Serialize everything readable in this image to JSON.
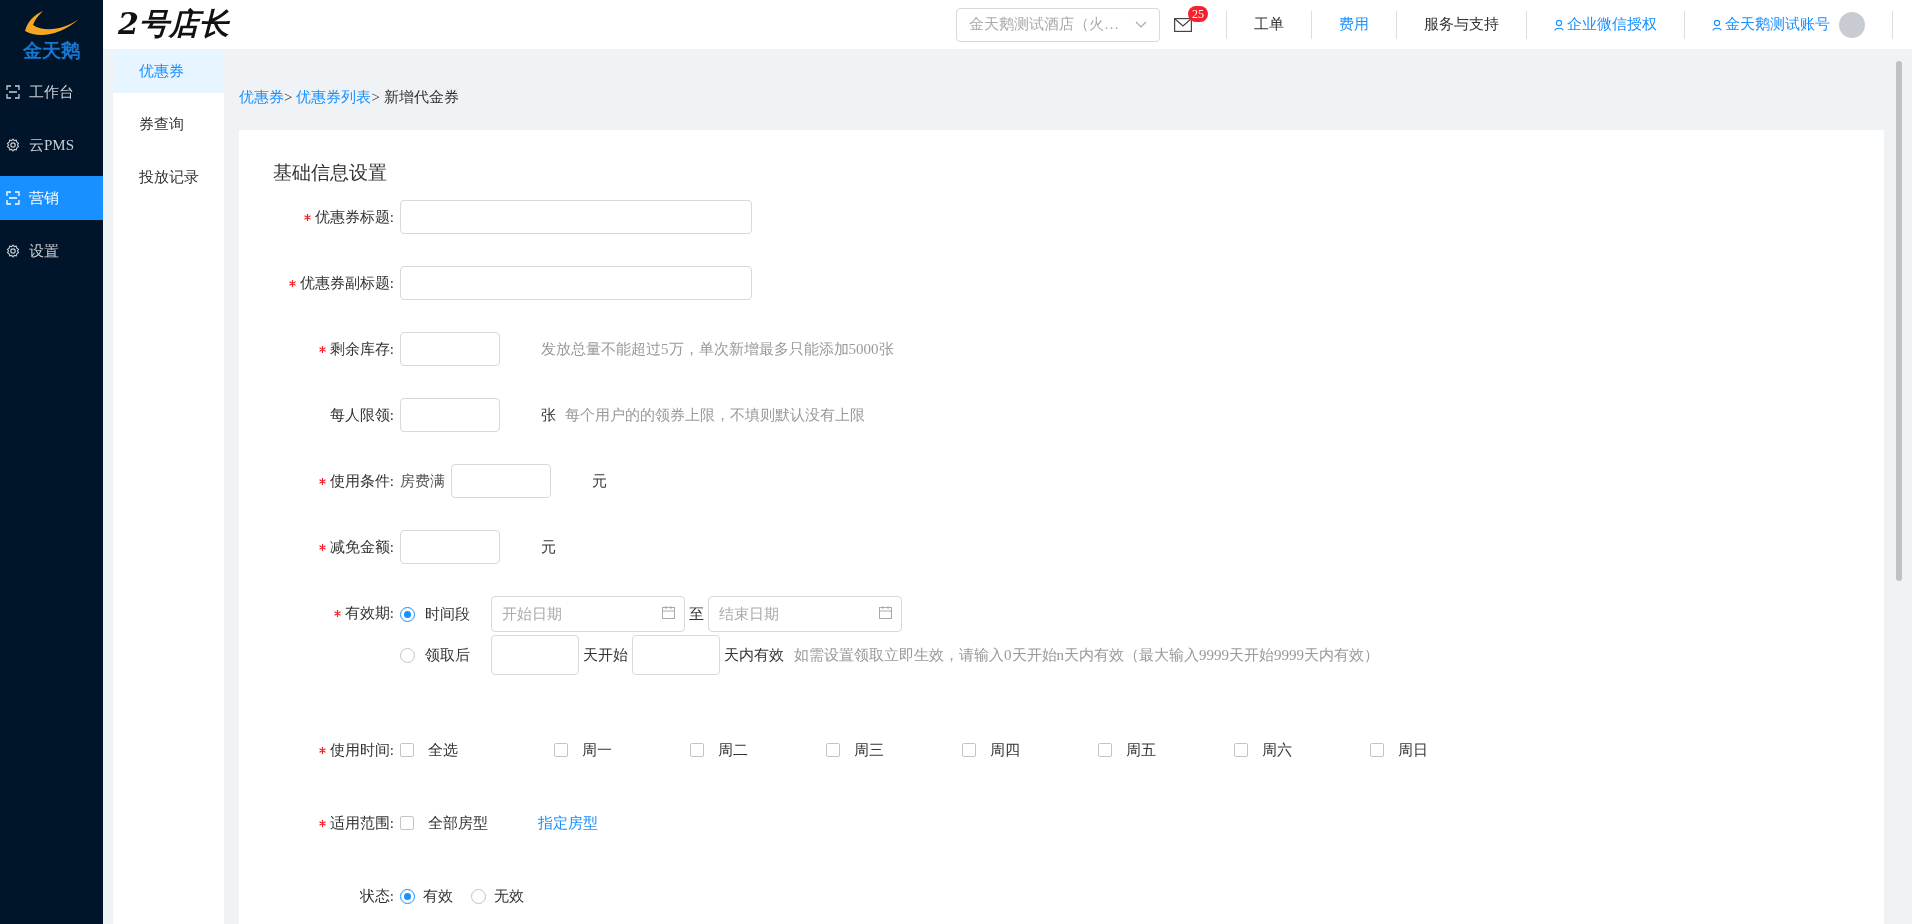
{
  "brand": {
    "logo_text": "金天鹅"
  },
  "nav": [
    {
      "label": "工作台",
      "kind": "frame",
      "selected": false
    },
    {
      "label": "云PMS",
      "kind": "gear",
      "selected": false
    },
    {
      "label": "营销",
      "kind": "frame",
      "selected": true
    },
    {
      "label": "设置",
      "kind": "gear",
      "selected": false
    }
  ],
  "header": {
    "app_title": "2号店长",
    "hotel_select": {
      "value": "金天鹅测试酒店（火…"
    },
    "mail_badge": "25",
    "links": [
      {
        "label": "工单",
        "kind": "text",
        "selected": false
      },
      {
        "label": "费用",
        "kind": "text",
        "selected": true
      },
      {
        "label": "服务与支持",
        "kind": "text",
        "selected": false
      },
      {
        "label": "企业微信授权",
        "kind": "user"
      },
      {
        "label": "金天鹅测试账号",
        "kind": "account"
      }
    ]
  },
  "subnav": [
    {
      "label": "优惠券",
      "selected": true
    },
    {
      "label": "券查询",
      "selected": false
    },
    {
      "label": "投放记录",
      "selected": false
    }
  ],
  "breadcrumb": [
    {
      "label": "优惠券",
      "kind": "link"
    },
    {
      "label": ">",
      "kind": "sep"
    },
    {
      "label": "优惠券列表",
      "kind": "link"
    },
    {
      "label": ">",
      "kind": "sep"
    },
    {
      "label": "新增代金券",
      "kind": "current"
    }
  ],
  "form": {
    "title": "基础信息设置",
    "rows": [
      {
        "kind": "wide-input",
        "label": "优惠券标题:",
        "required": true
      },
      {
        "kind": "wide-input",
        "label": "优惠券副标题:",
        "required": true
      },
      {
        "kind": "short-input",
        "label": "剩余库存:",
        "required": true,
        "hint": "发放总量不能超过5万，单次新增最多只能添加5000张"
      },
      {
        "kind": "short-input",
        "label": "每人限领:",
        "required": false,
        "unit": "张",
        "hint": "每个用户的的领券上限，不填则默认没有上限"
      },
      {
        "kind": "short-input",
        "label": "使用条件:",
        "required": true,
        "prefix": "房费满",
        "unit": "元"
      },
      {
        "kind": "short-input",
        "label": "减免金额:",
        "required": true,
        "unit": "元"
      },
      {
        "kind": "validity",
        "label": "有效期:",
        "required": true,
        "options": [
          {
            "kind": "range",
            "label": "时间段",
            "selected": true,
            "start_placeholder": "开始日期",
            "between": "至",
            "end_placeholder": "结束日期"
          },
          {
            "kind": "after",
            "label": "领取后",
            "selected": false,
            "start_text": "天开始",
            "end_text": "天内有效",
            "hint": "如需设置领取立即生效，请输入0天开始n天内有效（最大输入9999天开始9999天内有效）"
          }
        ]
      },
      {
        "kind": "checks",
        "label": "使用时间:",
        "required": true,
        "options": [
          {
            "label": "全选",
            "checked": false
          },
          {
            "label": "周一",
            "checked": false
          },
          {
            "label": "周二",
            "checked": false
          },
          {
            "label": "周三",
            "checked": false
          },
          {
            "label": "周四",
            "checked": false
          },
          {
            "label": "周五",
            "checked": false
          },
          {
            "label": "周六",
            "checked": false
          },
          {
            "label": "周日",
            "checked": false
          }
        ]
      },
      {
        "kind": "scope",
        "label": "适用范围:",
        "required": true,
        "options": [
          {
            "label": "全部房型",
            "checked": false
          }
        ],
        "link": "指定房型"
      },
      {
        "kind": "radios",
        "label": "状态:",
        "required": false,
        "options": [
          {
            "label": "有效",
            "selected": true
          },
          {
            "label": "无效",
            "selected": false
          }
        ]
      }
    ]
  }
}
